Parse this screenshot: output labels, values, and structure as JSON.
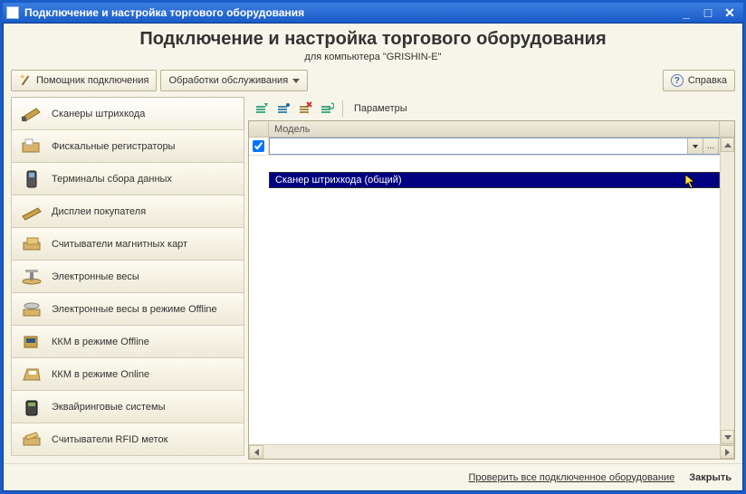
{
  "window": {
    "title": "Подключение и настройка торгового оборудования"
  },
  "header": {
    "title": "Подключение и настройка торгового оборудования",
    "subtitle": "для компьютера \"GRISHIN-E\""
  },
  "toolbar": {
    "assistant_label": "Помощник подключения",
    "maintenance_label": "Обработки обслуживания",
    "help_label": "Справка"
  },
  "sidebar": {
    "items": [
      {
        "label": "Сканеры штрихкода"
      },
      {
        "label": "Фискальные регистраторы"
      },
      {
        "label": "Терминалы сбора данных"
      },
      {
        "label": "Дисплеи покупателя"
      },
      {
        "label": "Считыватели магнитных карт"
      },
      {
        "label": "Электронные весы"
      },
      {
        "label": "Электронные весы в режиме Offline"
      },
      {
        "label": "ККМ в режиме Offline"
      },
      {
        "label": "ККМ в режиме Online"
      },
      {
        "label": "Эквайринговые системы"
      },
      {
        "label": "Считыватели RFID меток"
      }
    ]
  },
  "grid": {
    "toolbar_params": "Параметры",
    "column_model": "Модель",
    "combo_ellipsis": "...",
    "dropdown_item": "Сканер штрихкода (общий)"
  },
  "footer": {
    "check_all": "Проверить все подключенное оборудование",
    "close": "Закрыть"
  }
}
